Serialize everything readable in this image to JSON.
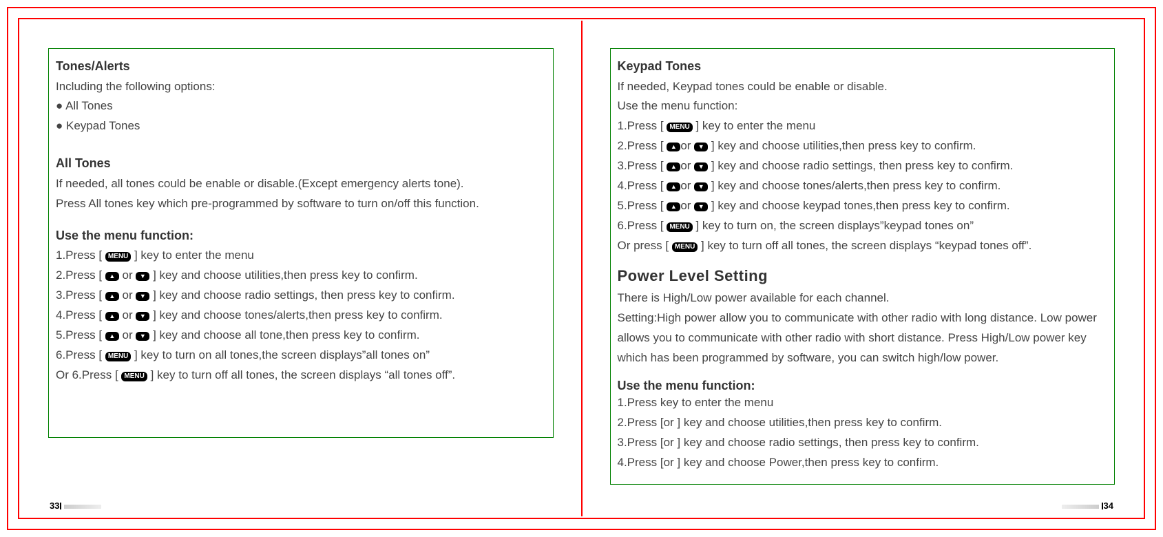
{
  "left": {
    "section1": {
      "title": "Tones/Alerts",
      "intro": "Including the following options:",
      "bullet1": "All Tones",
      "bullet2": "Keypad Tones"
    },
    "section2": {
      "title": "All Tones",
      "p1": "If needed, all tones could be enable or disable.(Except emergency alerts tone).",
      "p2": "Press All tones key which pre-programmed by software to turn on/off this function."
    },
    "section3": {
      "title": "Use the menu function:",
      "s1a": "1.Press [ ",
      "s1b": " ] key to enter the menu",
      "s2a": "2.Press [ ",
      "s2b": " or ",
      "s2c": " ] key and choose utilities,then press  key to confirm.",
      "s3a": "3.Press [ ",
      "s3b": " or ",
      "s3c": " ] key and choose radio settings, then press  key to confirm.",
      "s4a": "4.Press [ ",
      "s4b": " or ",
      "s4c": " ] key and choose tones/alerts,then press  key to confirm.",
      "s5a": "5.Press [ ",
      "s5b": " or ",
      "s5c": " ] key and choose all tone,then press  key to confirm.",
      "s6a": "6.Press [ ",
      "s6b": " ] key to turn on all tones,the screen displays”all tones on”",
      "s7a": "Or 6.Press [ ",
      "s7b": " ] key to turn off all tones, the screen displays “all tones off”."
    },
    "page": "33"
  },
  "right": {
    "section1": {
      "title": "Keypad Tones",
      "p1": "If needed, Keypad tones could be enable or disable.",
      "p2": "Use the menu function:",
      "s1a": "1.Press [ ",
      "s1b": " ] key to enter the menu",
      "s2a": "2.Press [ ",
      "s2b": "or ",
      "s2c": "  ] key and choose utilities,then press  key to confirm.",
      "s3a": "3.Press [ ",
      "s3b": "or ",
      "s3c": "  ] key and choose radio settings, then press  key to confirm.",
      "s4a": "4.Press [ ",
      "s4b": "or ",
      "s4c": "  ] key and choose tones/alerts,then press  key to confirm.",
      "s5a": "5.Press [ ",
      "s5b": "or ",
      "s5c": "  ] key and choose keypad tones,then press  key to confirm.",
      "s6a": "6.Press [ ",
      "s6b": " ] key to turn on, the screen displays”keypad tones on”",
      "s7a": "Or press [ ",
      "s7b": " ] key to turn off all tones, the screen displays “keypad tones off”."
    },
    "section2": {
      "title": "Power Level Setting",
      "p1": "There is High/Low power available for each channel.",
      "p2": "Setting:High power allow you to communicate with other radio with long distance. Low power allows you to communicate with other radio with short distance. Press High/Low power key which has been programmed by software, you can switch high/low power."
    },
    "section3": {
      "title": "Use the menu function:",
      "s1": "1.Press  key to enter the menu",
      "s2": "2.Press [or ] key and choose utilities,then press  key to confirm.",
      "s3": "3.Press [or ] key and choose radio settings, then press  key to confirm.",
      "s4": "4.Press [or ] key and choose Power,then press  key to confirm."
    },
    "page": "34"
  },
  "badges": {
    "menu": "MENU",
    "up": "▲",
    "down": "▼"
  }
}
